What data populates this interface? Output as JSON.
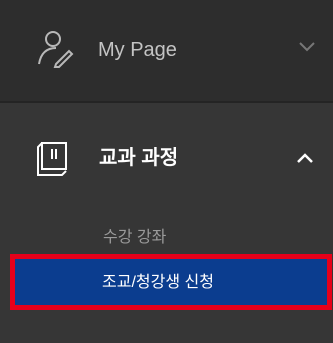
{
  "sidebar": {
    "my_page": {
      "label": "My Page",
      "icon": "user-edit-icon",
      "expanded": false
    },
    "course": {
      "label": "교과 과정",
      "icon": "book-icon",
      "expanded": true,
      "items": [
        {
          "label": "수강 강좌",
          "active": false
        },
        {
          "label": "조교/청강생 신청",
          "active": true
        }
      ]
    }
  },
  "colors": {
    "sidebar_bg": "#333333",
    "active_bg": "#0b3d8f",
    "highlight_border": "#e6001a"
  }
}
